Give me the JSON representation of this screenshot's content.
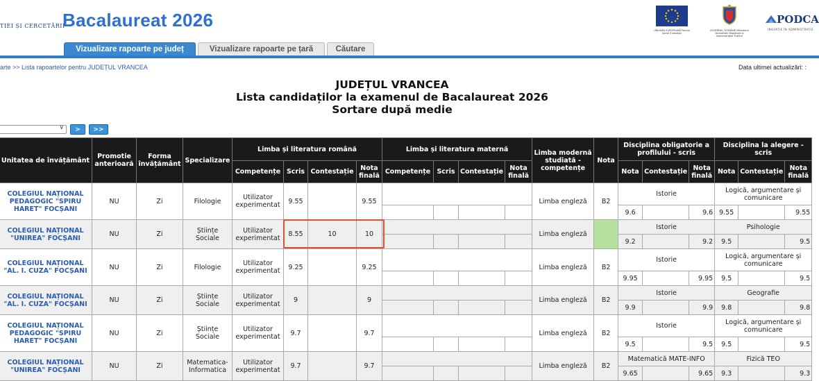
{
  "header": {
    "ministry_text": "TIEI ȘI CERCETĂRII",
    "app_title": "Bacalaureat 2026",
    "tabs": [
      {
        "label": "Vizualizare rapoarte pe județ"
      },
      {
        "label": "Vizualizare rapoarte pe țară"
      },
      {
        "label": "Căutare"
      }
    ],
    "logo_eu_caption": "UNIUNEA EUROPEANĂ Fondul Social European",
    "logo_gov_caption": "GUVERNUL ROMÂNIEI Ministerul Dezvoltării Regionale și Administrației Publice",
    "logo_podca": "PODCA",
    "logo_podca_sub": "INOVAȚIE ÎN ADMINISTRAȚIE"
  },
  "breadcrumb": "arte >> Lista rapoartelor pentru JUDEȚUL VRANCEA",
  "last_update_label": "Data ultimei actualizări: :",
  "title_lines": [
    "JUDEȚUL VRANCEA",
    "Lista candidaților la examenul de Bacalaureat 2026",
    "Sortare după medie"
  ],
  "pager": {
    "next_label": ">",
    "last_label": ">>"
  },
  "table": {
    "headers": {
      "unitate": "Unitatea de învățământ",
      "promotie": "Promotie anterioară",
      "forma": "Forma învățământ",
      "specializare": "Specializare",
      "romana": "Limba și literatura română",
      "materna": "Limba și literatura maternă",
      "limba_moderna": "Limba modernă studiată - competențe",
      "nota": "Nota",
      "disc_obligatorie": "Disciplina obligatorie a profilului - scris",
      "disc_alegere": "Disciplina la alegere - scris",
      "competente": "Competențe",
      "scris": "Scris",
      "contestatie": "Contestație",
      "nota_finala": "Nota finală",
      "nota_sub": "Nota"
    },
    "rows": [
      {
        "unitate": "COLEGIUL NAȚIONAL PEDAGOGIC \"SPIRU HARET\" FOCȘANI",
        "promotie": "NU",
        "forma": "Zi",
        "specializare": "Filologie",
        "competente": "Utilizator experimentat",
        "scris": "9.55",
        "contestatie": "",
        "nota_finala": "9.55",
        "limba_moderna": "Limba engleză",
        "nota": "B2",
        "disc_obl": "Istorie",
        "obl_nota": "9.6",
        "obl_cont": "",
        "obl_final": "9.6",
        "disc_ale": "Logică, argumentare și comunicare",
        "ale_nota": "9.55",
        "ale_cont": "",
        "ale_final": "9.55"
      },
      {
        "unitate": "COLEGIUL NAȚIONAL \"UNIREA\" FOCȘANI",
        "promotie": "NU",
        "forma": "Zi",
        "specializare": "Științe Sociale",
        "competente": "Utilizator experimentat",
        "scris": "8.55",
        "contestatie": "10",
        "nota_finala": "10",
        "limba_moderna": "Limba engleză",
        "nota": "",
        "disc_obl": "Istorie",
        "obl_nota": "9.2",
        "obl_cont": "",
        "obl_final": "9.2",
        "disc_ale": "Psihologie",
        "ale_nota": "9.5",
        "ale_cont": "",
        "ale_final": "9.5"
      },
      {
        "unitate": "COLEGIUL NAȚIONAL \"AL. I. CUZA\" FOCȘANI",
        "promotie": "NU",
        "forma": "Zi",
        "specializare": "Filologie",
        "competente": "Utilizator experimentat",
        "scris": "9.25",
        "contestatie": "",
        "nota_finala": "9.25",
        "limba_moderna": "Limba engleză",
        "nota": "B2",
        "disc_obl": "Istorie",
        "obl_nota": "9.95",
        "obl_cont": "",
        "obl_final": "9.95",
        "disc_ale": "Logică, argumentare și comunicare",
        "ale_nota": "9.5",
        "ale_cont": "",
        "ale_final": "9.5"
      },
      {
        "unitate": "COLEGIUL NAȚIONAL \"AL. I. CUZA\" FOCȘANI",
        "promotie": "NU",
        "forma": "Zi",
        "specializare": "Științe Sociale",
        "competente": "Utilizator experimentat",
        "scris": "9",
        "contestatie": "",
        "nota_finala": "9",
        "limba_moderna": "Limba engleză",
        "nota": "B2",
        "disc_obl": "Istorie",
        "obl_nota": "9.9",
        "obl_cont": "",
        "obl_final": "9.9",
        "disc_ale": "Geografie",
        "ale_nota": "9.8",
        "ale_cont": "",
        "ale_final": "9.8"
      },
      {
        "unitate": "COLEGIUL NAȚIONAL PEDAGOGIC \"SPIRU HARET\" FOCȘANI",
        "promotie": "NU",
        "forma": "Zi",
        "specializare": "Științe Sociale",
        "competente": "Utilizator experimentat",
        "scris": "9.7",
        "contestatie": "",
        "nota_finala": "9.7",
        "limba_moderna": "Limba engleză",
        "nota": "B2",
        "disc_obl": "Istorie",
        "obl_nota": "9.5",
        "obl_cont": "",
        "obl_final": "9.5",
        "disc_ale": "Logică, argumentare și comunicare",
        "ale_nota": "9.5",
        "ale_cont": "",
        "ale_final": "9.5"
      },
      {
        "unitate": "COLEGIUL NAȚIONAL \"UNIREA\" FOCȘANI",
        "promotie": "NU",
        "forma": "Zi",
        "specializare": "Matematica-Informatica",
        "competente": "Utilizator experimentat",
        "scris": "9.7",
        "contestatie": "",
        "nota_finala": "9.7",
        "limba_moderna": "Limba engleză",
        "nota": "B2",
        "disc_obl": "Matematică MATE-INFO",
        "obl_nota": "9.65",
        "obl_cont": "",
        "obl_final": "9.65",
        "disc_ale": "Fizică TEO",
        "ale_nota": "9.3",
        "ale_cont": "",
        "ale_final": "9.3"
      }
    ]
  }
}
